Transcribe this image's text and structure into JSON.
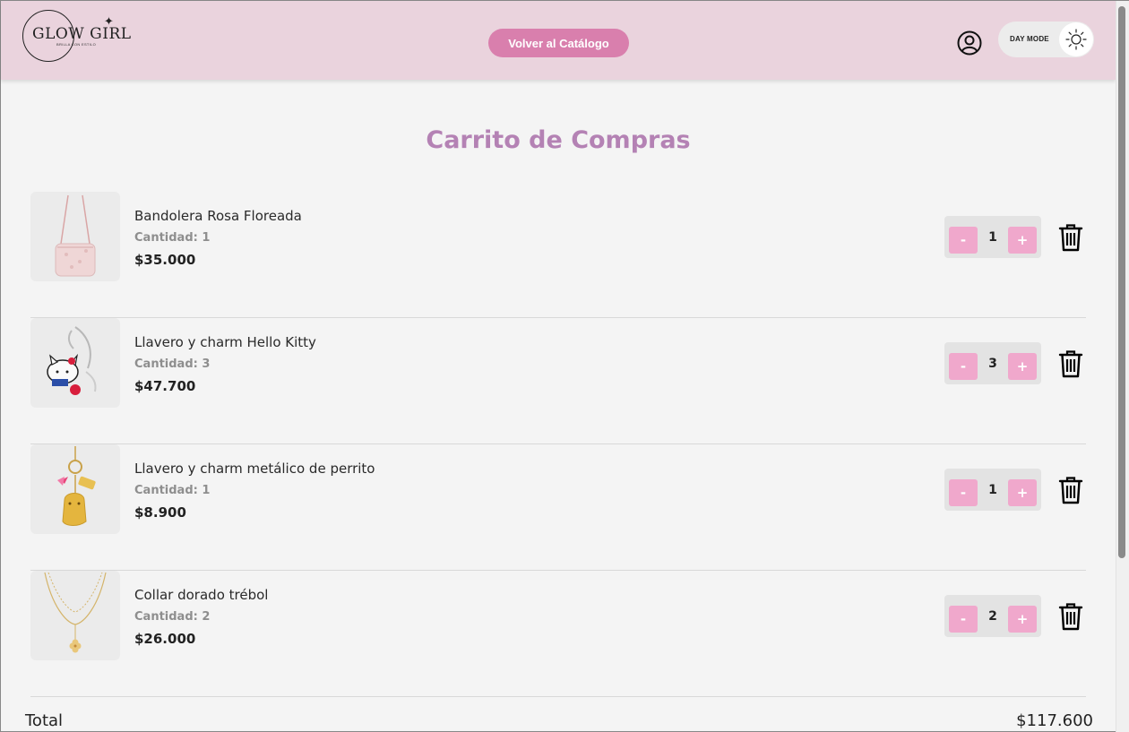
{
  "header": {
    "logo_text": "GLOW GIRL",
    "logo_sub": "BRILLA CON ESTILO",
    "back_button": "Volver al Catálogo",
    "mode_label": "DAY MODE"
  },
  "page_title": "Carrito de Compras",
  "items": [
    {
      "name": "Bandolera Rosa Floreada",
      "qty_text": "Cantidad: 1",
      "price": "$35.000",
      "qty": "1",
      "image": "pink-floral-crossbody-bag"
    },
    {
      "name": "Llavero y charm Hello Kitty",
      "qty_text": "Cantidad: 3",
      "price": "$47.700",
      "qty": "3",
      "image": "hello-kitty-keychain"
    },
    {
      "name": "Llavero y charm metálico de perrito",
      "qty_text": "Cantidad: 1",
      "price": "$8.900",
      "qty": "1",
      "image": "gold-puppy-keychain"
    },
    {
      "name": "Collar dorado trébol",
      "qty_text": "Cantidad: 2",
      "price": "$26.000",
      "qty": "2",
      "image": "gold-clover-necklace"
    }
  ],
  "stepper": {
    "minus": "-",
    "plus": "+"
  },
  "total": {
    "label": "Total",
    "value": "$117.600"
  },
  "colors": {
    "header_bg": "#ead3dd",
    "accent": "#d97fad",
    "title": "#b482b4",
    "stepper_btn": "#f0a8cc"
  }
}
